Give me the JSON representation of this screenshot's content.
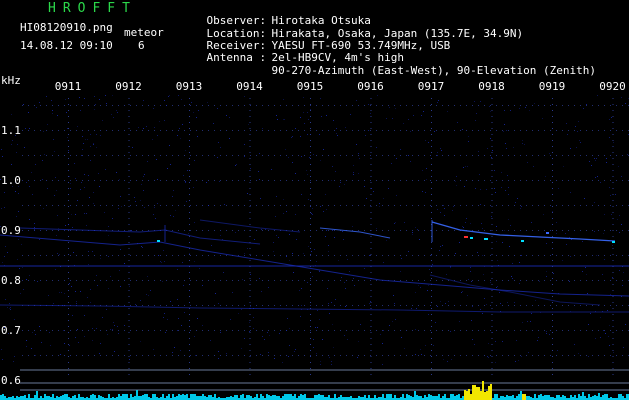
{
  "header": {
    "app_name": "HROFFT",
    "file_name": "HI08120910.png",
    "timestamp": "14.08.12 09:10",
    "mode_label": "meteor",
    "meteor_count": "6"
  },
  "metadata": [
    {
      "key": "Observer",
      "sep": ":",
      "value": "Hirotaka Otsuka"
    },
    {
      "key": "Location",
      "sep": ":",
      "value": "Hirakata, Osaka, Japan (135.7E, 34.9N)"
    },
    {
      "key": "Receiver",
      "sep": ":",
      "value": "YAESU FT-690 53.749MHz, USB"
    },
    {
      "key": "Antenna",
      "sep": ":",
      "value": "2el-HB9CV, 4m's high"
    },
    {
      "key": "",
      "sep": "",
      "value": "90-270-Azimuth (East-West), 90-Elevation (Zenith)"
    }
  ],
  "axis": {
    "unit_label": "kHz",
    "time_ticks": [
      "0911",
      "0912",
      "0913",
      "0914",
      "0915",
      "0916",
      "0917",
      "0918",
      "0919",
      "0920"
    ],
    "freq_ticks": [
      "1.1",
      "1.0",
      "0.9",
      "0.8",
      "0.7",
      "0.6"
    ]
  },
  "colors": {
    "title_green": "#2bd84a",
    "text": "#ffffff",
    "grid_dots": "#2a3a8c",
    "trace_blue": "#1c30c8",
    "bright_trace": "#3a6aff",
    "echo_cyan": "#00e0ff",
    "echo_red": "#ff3030",
    "ref_line": "#6a7a9a",
    "noise_cyan": "#00c8e8",
    "noise_yellow": "#f2e600"
  }
}
